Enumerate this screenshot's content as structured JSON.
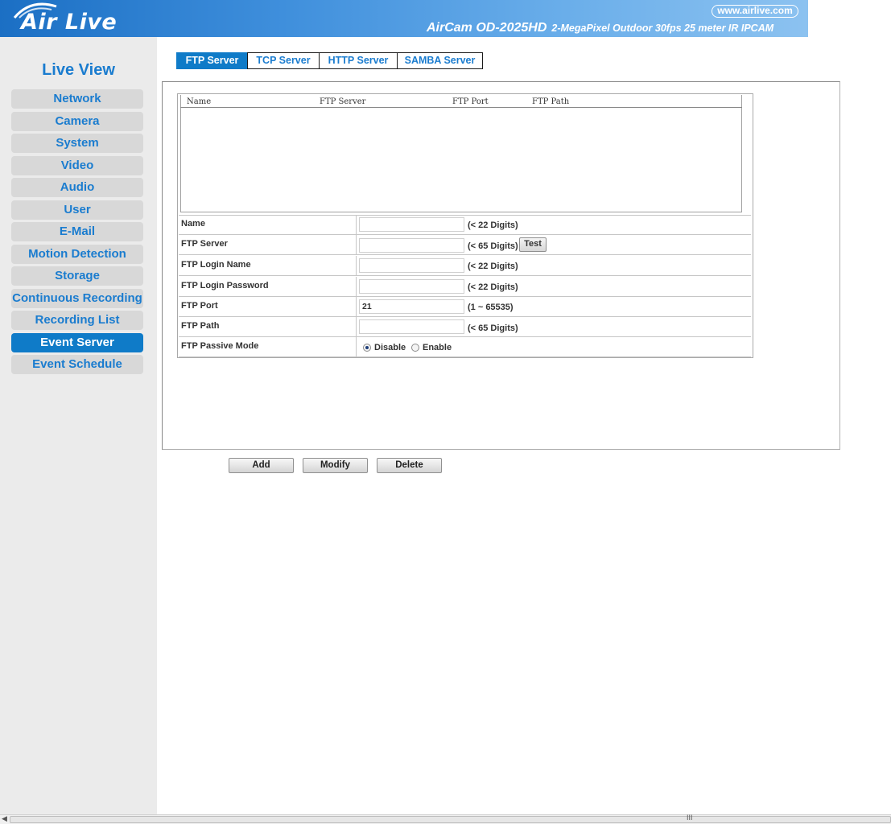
{
  "header": {
    "logo_text": "Air Live",
    "url": "www.airlive.com",
    "model": "AirCam OD-2025HD",
    "description": "2-MegaPixel Outdoor 30fps 25 meter IR IPCAM"
  },
  "sidebar": {
    "title": "Live View",
    "items": [
      {
        "label": "Network"
      },
      {
        "label": "Camera"
      },
      {
        "label": "System"
      },
      {
        "label": "Video"
      },
      {
        "label": "Audio"
      },
      {
        "label": "User"
      },
      {
        "label": "E-Mail"
      },
      {
        "label": "Motion Detection"
      },
      {
        "label": "Storage"
      },
      {
        "label": "Continuous Recording"
      },
      {
        "label": "Recording List"
      },
      {
        "label": "Event Server"
      },
      {
        "label": "Event Schedule"
      }
    ],
    "active": "Event Server"
  },
  "tabs": [
    {
      "label": "FTP Server"
    },
    {
      "label": "TCP Server"
    },
    {
      "label": "HTTP Server"
    },
    {
      "label": "SAMBA Server"
    }
  ],
  "list": {
    "columns": [
      "Name",
      "FTP Server",
      "FTP Port",
      "FTP Path"
    ],
    "rows": []
  },
  "form": {
    "name": {
      "label": "Name",
      "value": "",
      "hint": "(< 22 Digits)"
    },
    "ftp_server": {
      "label": "FTP Server",
      "value": "",
      "hint": "(< 65 Digits)",
      "test_label": "Test"
    },
    "login_name": {
      "label": "FTP Login Name",
      "value": "",
      "hint": "(< 22 Digits)"
    },
    "login_password": {
      "label": "FTP Login Password",
      "value": "",
      "hint": "(< 22 Digits)"
    },
    "port": {
      "label": "FTP Port",
      "value": "21",
      "hint": "(1 ~ 65535)"
    },
    "path": {
      "label": "FTP Path",
      "value": "",
      "hint": "(< 65 Digits)"
    },
    "passive": {
      "label": "FTP Passive Mode",
      "options": [
        "Disable",
        "Enable"
      ],
      "selected": "Disable"
    }
  },
  "actions": {
    "add": "Add",
    "modify": "Modify",
    "delete": "Delete"
  },
  "scrollbar": {
    "grip": "III"
  },
  "colors": {
    "accent": "#0f7bc8",
    "link": "#1a7ccf"
  }
}
